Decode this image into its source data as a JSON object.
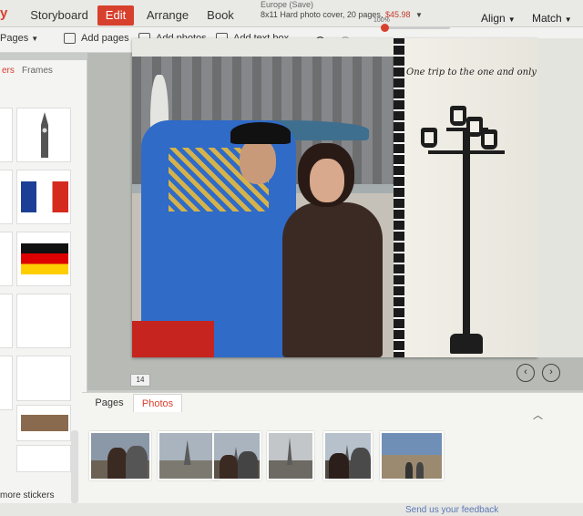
{
  "nav": {
    "logo": "y",
    "tabs": [
      "Storyboard",
      "Edit",
      "Arrange",
      "Book"
    ],
    "active_tab": "Edit",
    "project_title": "Europe (Save)",
    "project_info": "8x11 Hard photo cover, 20 pages,",
    "price": "$45.98",
    "align_label": "Align",
    "match_label": "Match"
  },
  "toolbar": {
    "pages_dropdown": "Pages",
    "add_pages": "Add pages",
    "add_photos": "Add photos",
    "add_text": "Add text box",
    "zoom_label": "100%",
    "zoom_level": 0.0
  },
  "left_panel": {
    "tab_stickers": "ers",
    "tab_frames": "Frames",
    "more_stickers": "more stickers"
  },
  "canvas": {
    "script_text": "One trip to the one and only",
    "page_number": "14"
  },
  "tray": {
    "tab_pages": "Pages",
    "tab_photos": "Photos",
    "active_tab": "Photos",
    "thumbnails": [
      "thumb-couple-selfie",
      "thumb-eiffel-1",
      "thumb-selfie-eiffel",
      "thumb-eiffel-2",
      "thumb-couple-eiffel",
      "thumb-plaza"
    ]
  },
  "status": {
    "feedback": "Send us your feedback"
  },
  "colors": {
    "accent": "#d8402e",
    "link": "#5a78b5"
  }
}
